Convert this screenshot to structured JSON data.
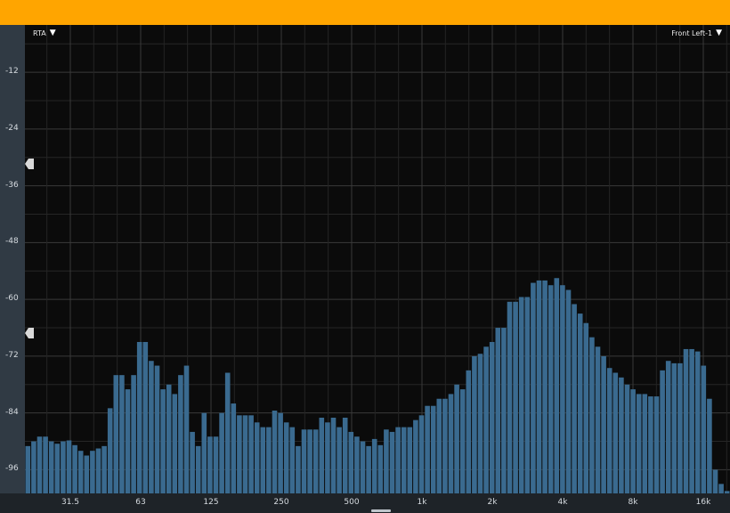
{
  "window": {
    "accent": "#ffa500"
  },
  "header": {
    "mode_label": "RTA",
    "channel_label": "Front Left-1",
    "dropdown_icon": "triangle-down-icon"
  },
  "chart_data": {
    "type": "bar",
    "ylim": [
      -101,
      -2
    ],
    "yticks": [
      -12,
      -24,
      -36,
      -48,
      -60,
      -72,
      -84,
      -96
    ],
    "xticks": [
      "31.5",
      "63",
      "125",
      "250",
      "500",
      "1k",
      "2k",
      "4k",
      "8k",
      "16k"
    ],
    "grid": true,
    "bar_color": "#3a6a8f",
    "values": [
      -91,
      -90,
      -89,
      -89,
      -90,
      -90.5,
      -90,
      -89.8,
      -90.8,
      -92,
      -93,
      -92,
      -91.5,
      -91,
      -83,
      -76,
      -76,
      -79,
      -76,
      -69,
      -69,
      -73,
      -74,
      -79,
      -78,
      -80,
      -76,
      -74,
      -88,
      -91,
      -84,
      -89,
      -89,
      -84,
      -75.5,
      -82,
      -84.5,
      -84.5,
      -84.5,
      -86,
      -87,
      -87,
      -83.5,
      -84,
      -86,
      -87,
      -91,
      -87.5,
      -87.5,
      -87.5,
      -85,
      -86,
      -85,
      -87,
      -85,
      -88,
      -89,
      -90,
      -91,
      -89.5,
      -90.8,
      -87.5,
      -88,
      -87,
      -87,
      -87,
      -85.5,
      -84.5,
      -82.5,
      -82.5,
      -81,
      -81,
      -80,
      -78,
      -79,
      -75,
      -72,
      -71.5,
      -70,
      -69,
      -66,
      -66,
      -60.5,
      -60.5,
      -59.5,
      -59.5,
      -56.5,
      -56,
      -56,
      -57,
      -55.5,
      -57,
      -58,
      -61,
      -63,
      -65,
      -68,
      -70,
      -72,
      -74.5,
      -75.5,
      -76.5,
      -78,
      -79,
      -80,
      -80,
      -80.5,
      -80.5,
      -75,
      -73,
      -73.5,
      -73.5,
      -70.5,
      -70.5,
      -71,
      -74,
      -81,
      -96,
      -99,
      -100.5
    ]
  }
}
